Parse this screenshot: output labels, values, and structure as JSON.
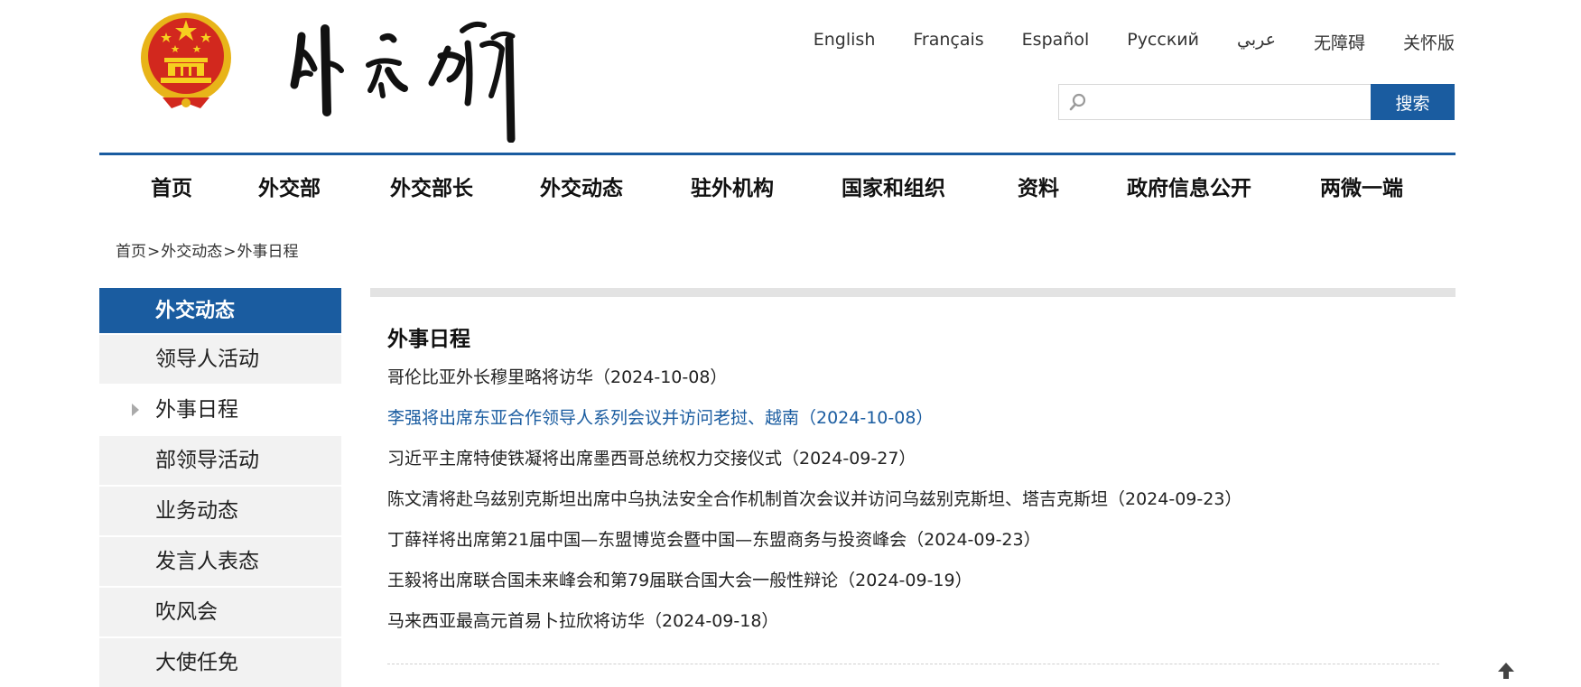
{
  "header": {
    "languages": [
      "English",
      "Français",
      "Español",
      "Русский",
      "عربي",
      "无障碍",
      "关怀版"
    ],
    "search": {
      "placeholder": "",
      "button_label": "搜索"
    }
  },
  "nav": {
    "items": [
      "首页",
      "外交部",
      "外交部长",
      "外交动态",
      "驻外机构",
      "国家和组织",
      "资料",
      "政府信息公开",
      "两微一端"
    ]
  },
  "breadcrumb": [
    "首页",
    "外交动态",
    "外事日程"
  ],
  "breadcrumb_sep": ">",
  "sidebar": {
    "title": "外交动态",
    "items": [
      "领导人活动",
      "外事日程",
      "部领导活动",
      "业务动态",
      "发言人表态",
      "吹风会",
      "大使任免"
    ],
    "active_index": 1
  },
  "content": {
    "title": "外事日程",
    "items": [
      "哥伦比亚外长穆里略将访华（2024-10-08）",
      "李强将出席东亚合作领导人系列会议并访问老挝、越南（2024-10-08）",
      "习近平主席特使铁凝将出席墨西哥总统权力交接仪式（2024-09-27）",
      "陈文清将赴乌兹别克斯坦出席中乌执法安全合作机制首次会议并访问乌兹别克斯坦、塔吉克斯坦（2024-09-23）",
      "丁薛祥将出席第21届中国—东盟博览会暨中国—东盟商务与投资峰会（2024-09-23）",
      "王毅将出席联合国未来峰会和第79届联合国大会一般性辩论（2024-09-19）",
      "马来西亚最高元首易卜拉欣将访华（2024-09-18）"
    ],
    "highlight_index": 1
  },
  "colors": {
    "accent": "#1a5ca0",
    "sidebar_bg": "#f2f2f2",
    "bar_gray": "#e3e3e3"
  },
  "icons": {
    "emblem": "national-emblem-icon",
    "search": "search-icon",
    "back_to_top": "arrow-up-icon"
  }
}
